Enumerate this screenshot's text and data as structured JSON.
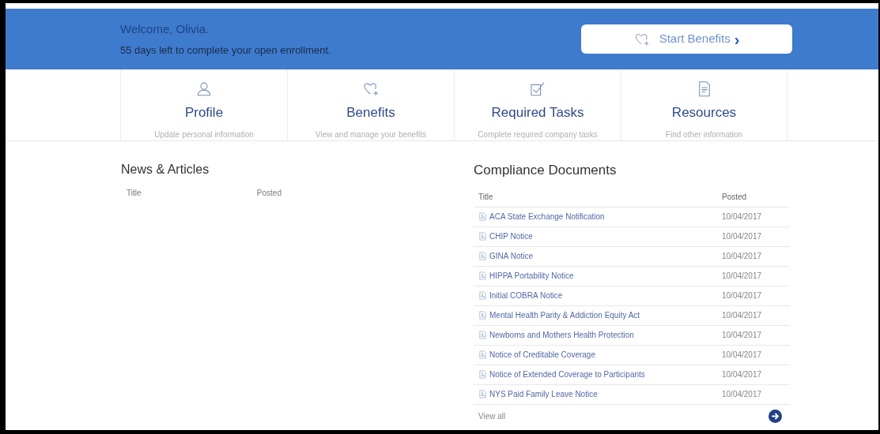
{
  "banner": {
    "welcome": "Welcome, Olivia.",
    "message": "55 days left to complete your open enrollment.",
    "button": {
      "label": "Start Benefits",
      "chevron": "›"
    }
  },
  "tiles": [
    {
      "title": "Profile",
      "subtitle": "Update personal information"
    },
    {
      "title": "Benefits",
      "subtitle": "View and manage your benefits"
    },
    {
      "title": "Required Tasks",
      "subtitle": "Complete required company tasks"
    },
    {
      "title": "Resources",
      "subtitle": "Find other information"
    }
  ],
  "news": {
    "title": "News & Articles",
    "columns": [
      "Title",
      "Posted"
    ]
  },
  "compliance": {
    "title": "Compliance Documents",
    "columns": [
      "Title",
      "Posted"
    ],
    "rows": [
      {
        "title": "ACA State Exchange Notification",
        "posted": "10/04/2017"
      },
      {
        "title": "CHIP Notice",
        "posted": "10/04/2017"
      },
      {
        "title": "GINA Notice",
        "posted": "10/04/2017"
      },
      {
        "title": "HIPPA Portability Notice",
        "posted": "10/04/2017"
      },
      {
        "title": "Initial COBRA Notice",
        "posted": "10/04/2017"
      },
      {
        "title": "Mental Health Parity & Addiction Equity Act",
        "posted": "10/04/2017"
      },
      {
        "title": "Newborns and Mothers Health Protection",
        "posted": "10/04/2017"
      },
      {
        "title": "Notice of Creditable Coverage",
        "posted": "10/04/2017"
      },
      {
        "title": "Notice of Extended Coverage to Participants",
        "posted": "10/04/2017"
      },
      {
        "title": "NYS Paid Family Leave Notice",
        "posted": "10/04/2017"
      }
    ],
    "view_all": "View all"
  }
}
